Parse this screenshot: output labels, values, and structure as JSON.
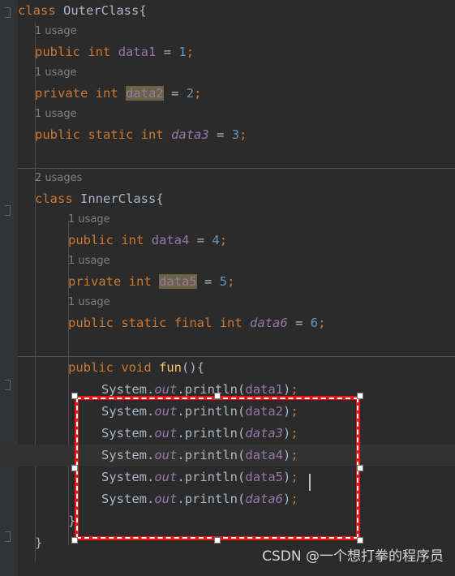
{
  "editor": {
    "theme_background": "#2b2b2b",
    "gutter_background": "#313335",
    "caret_line_background": "#323232",
    "accent_annotation_color": "#ee1111",
    "identifier_highlight_color": "#6b6444",
    "language": "Java"
  },
  "watermark": {
    "text": "CSDN @一个想打拳的程序员"
  },
  "code": {
    "line1": {
      "kw_class": "class",
      "space": " ",
      "name": "OuterClass",
      "brace": "{"
    },
    "usage1": "1 usage",
    "line2": {
      "kw_public": "public",
      "kw_int": "int",
      "field": "data1",
      "eq": "=",
      "value": "1",
      "semi": ";"
    },
    "usage2": "1 usage",
    "line3": {
      "kw_private": "private",
      "kw_int": "int",
      "field": "data2",
      "eq": "=",
      "value": "2",
      "semi": ";"
    },
    "usage3": "1 usage",
    "line4": {
      "kw_public": "public",
      "kw_static": "static",
      "kw_int": "int",
      "field": "data3",
      "eq": "=",
      "value": "3",
      "semi": ";"
    },
    "usage4": "2 usages",
    "line5": {
      "kw_class": "class",
      "name": "InnerClass",
      "brace": "{"
    },
    "usage5": "1 usage",
    "line6": {
      "kw_public": "public",
      "kw_int": "int",
      "field": "data4",
      "eq": "=",
      "value": "4",
      "semi": ";"
    },
    "usage6": "1 usage",
    "line7": {
      "kw_private": "private",
      "kw_int": "int",
      "field": "data5",
      "eq": "=",
      "value": "5",
      "semi": ";"
    },
    "usage7": "1 usage",
    "line8": {
      "kw_public": "public",
      "kw_static": "static",
      "kw_final": "final",
      "kw_int": "int",
      "field": "data6",
      "eq": "=",
      "value": "6",
      "semi": ";"
    },
    "line9": {
      "kw_public": "public",
      "kw_void": "void",
      "method": "fun",
      "parens": "()",
      "brace": "{"
    },
    "print1": {
      "sys": "System",
      "dot1": ".",
      "out": "out",
      "dot2": ".",
      "println": "println",
      "lp": "(",
      "arg": "data1",
      "rp": ")",
      "semi": ";"
    },
    "print2": {
      "sys": "System",
      "dot1": ".",
      "out": "out",
      "dot2": ".",
      "println": "println",
      "lp": "(",
      "arg": "data2",
      "rp": ")",
      "semi": ";"
    },
    "print3": {
      "sys": "System",
      "dot1": ".",
      "out": "out",
      "dot2": ".",
      "println": "println",
      "lp": "(",
      "arg": "data3",
      "rp": ")",
      "semi": ";"
    },
    "print4": {
      "sys": "System",
      "dot1": ".",
      "out": "out",
      "dot2": ".",
      "println": "println",
      "lp": "(",
      "arg": "data4",
      "rp": ")",
      "semi": ";"
    },
    "print5": {
      "sys": "System",
      "dot1": ".",
      "out": "out",
      "dot2": ".",
      "println": "println",
      "lp": "(",
      "arg": "data5",
      "rp": ")",
      "semi": ";"
    },
    "print6": {
      "sys": "System",
      "dot1": ".",
      "out": "out",
      "dot2": ".",
      "println": "println",
      "lp": "(",
      "arg": "data6",
      "rp": ")",
      "semi": ";"
    },
    "close_method": "}",
    "close_inner": "}",
    "close_outer": "}"
  }
}
